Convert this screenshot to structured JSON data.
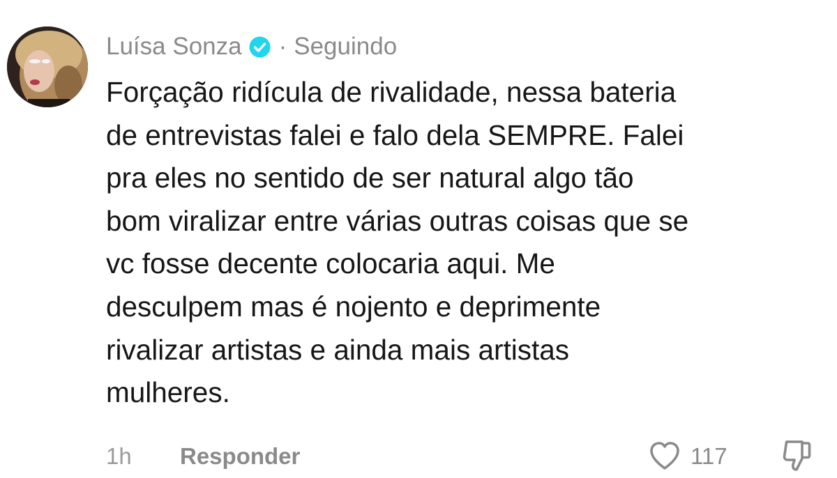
{
  "comment": {
    "author": "Luísa Sonza",
    "separator": "·",
    "follow_status": "Seguindo",
    "text_lines": [
      "Forçação ridícula de rivalidade, nessa bateria",
      "de entrevistas falei e falo dela SEMPRE. Falei",
      "pra eles no sentido de ser natural algo tão",
      "bom viralizar entre várias outras coisas que se",
      "vc fosse decente colocaria aqui. Me",
      "desculpem mas é nojento e deprimente",
      "rivalizar artistas e ainda mais artistas",
      "mulheres."
    ],
    "time": "1h",
    "reply_label": "Responder",
    "like_count": "117"
  },
  "icons": {
    "verified": "verified-badge-icon",
    "like": "heart-outline-icon",
    "dislike": "thumbs-down-icon"
  },
  "colors": {
    "verified_badge": "#20d5ec",
    "meta_text": "#8a8a8a",
    "body_text": "#161616"
  }
}
